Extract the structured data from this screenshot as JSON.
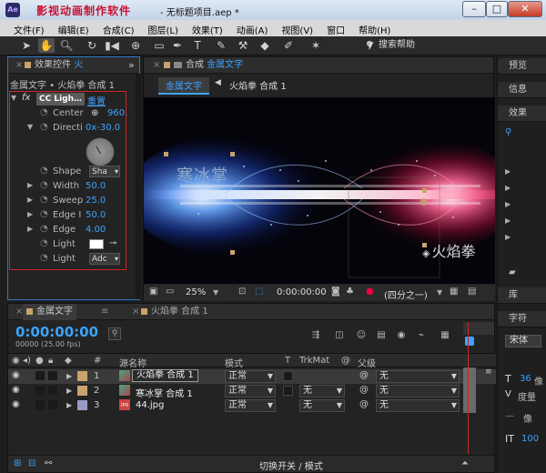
{
  "window": {
    "brand": "影视动画制作软件",
    "title": "- 无标题项目.aep *",
    "minimize": "–",
    "maximize": "□",
    "close": "✕"
  },
  "menu": [
    "文件(F)",
    "编辑(E)",
    "合成(C)",
    "图层(L)",
    "效果(T)",
    "动画(A)",
    "视图(V)",
    "窗口",
    "帮助(H)"
  ],
  "toolbar": {
    "search_label": "搜索帮助"
  },
  "effects_panel": {
    "tab_label": "效果控件",
    "tab_suffix": "火",
    "layer_path": "金属文字 • 火焰拳 合成 1",
    "fx_label": "fx",
    "effect_name": "CC Ligh…",
    "reset_label": "重置",
    "rows": [
      {
        "label": "Center",
        "value": "960."
      },
      {
        "label": "Directi",
        "value": "0x-30.0"
      },
      {
        "label": "Shape",
        "value": "Sha"
      },
      {
        "label": "Width",
        "value": "50.0"
      },
      {
        "label": "Sweep",
        "value": "25.0"
      },
      {
        "label": "Edge I",
        "value": "50.0"
      },
      {
        "label": "Edge",
        "value": "4.00"
      },
      {
        "label": "Light",
        "value": ""
      },
      {
        "label": "Light",
        "value": "Adc"
      }
    ]
  },
  "comp_panel": {
    "tab_label": "合成",
    "tab_active_name": "金属文字",
    "breadcrumb_active": "金属文字",
    "breadcrumb_next": "火焰拳 合成 1",
    "text_left": "寒冰掌",
    "text_right": "火焰拳",
    "zoom": "25%",
    "timecode": "0:00:00:00",
    "resolution": "(四分之一)"
  },
  "right_panel": {
    "tabs": [
      "预览",
      "信息",
      "效果",
      "库",
      "字符"
    ],
    "font_label": "宋体",
    "font_size": "36",
    "font_size_unit": "像",
    "tracking_label": "度量",
    "leading_label": "像",
    "scale_value": "100"
  },
  "timeline": {
    "tab_active": "金属文字",
    "tab_other": "火焰拳 合成 1",
    "timecode": "0:00:00:00",
    "fps": "00000 (25.00 fps)",
    "headers": {
      "number": "#",
      "source_name": "源名称",
      "mode": "模式",
      "t": "T",
      "trkmat": "TrkMat",
      "parent": "父级"
    },
    "layers": [
      {
        "num": "1",
        "name": "火焰拳 合成 1",
        "mode": "正常",
        "trkmat": "",
        "parent": "无",
        "color": "#c9a26d"
      },
      {
        "num": "2",
        "name": "寒冰掌 合成 1",
        "mode": "正常",
        "trkmat": "无",
        "parent": "无",
        "color": "#c9a26d"
      },
      {
        "num": "3",
        "name": "44.jpg",
        "mode": "正常",
        "trkmat": "无",
        "parent": "无",
        "color": "#9a9ac8"
      }
    ],
    "footer_label": "切换开关 / 模式"
  }
}
